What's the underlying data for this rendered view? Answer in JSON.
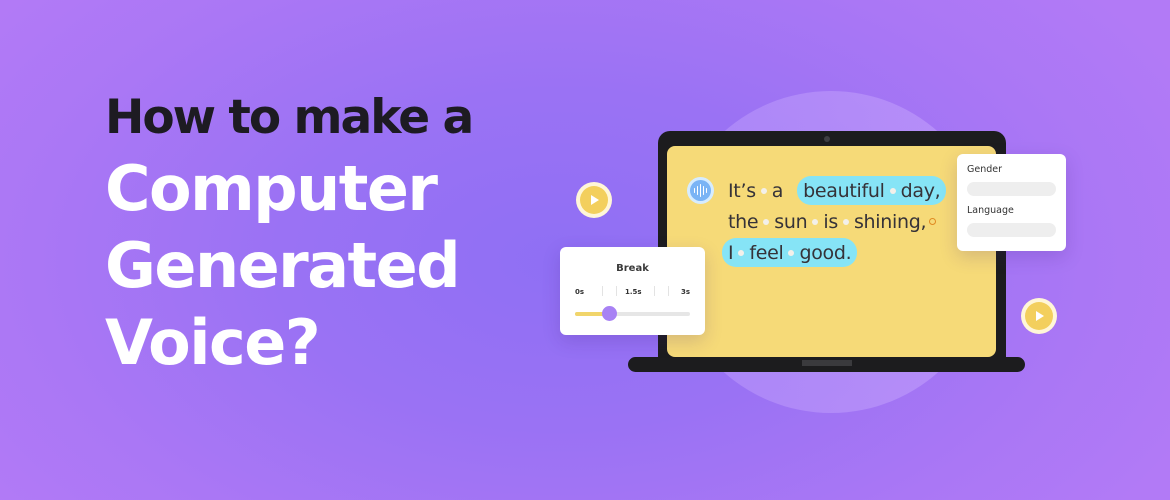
{
  "headline": {
    "line1": "How to make a",
    "line2": "Computer",
    "line3": "Generated",
    "line4": "Voice?"
  },
  "editor": {
    "sentence_lines": [
      [
        "It’s",
        "a",
        "beautiful",
        "day,"
      ],
      [
        "the",
        "sun",
        "is",
        "shining,"
      ],
      [
        "I",
        "feel",
        "good."
      ]
    ],
    "highlighted_phrases": [
      "beautiful day,",
      "I feel good."
    ],
    "icon": "sound-wave-icon"
  },
  "voice_settings": {
    "gender_label": "Gender",
    "gender_value": "",
    "language_label": "Language",
    "language_value": ""
  },
  "break_control": {
    "title": "Break",
    "tick_labels": [
      "0s",
      "1.5s",
      "3s"
    ],
    "min_seconds": 0,
    "max_seconds": 3,
    "value_seconds": 0.9
  },
  "play_buttons": [
    "play-icon",
    "play-icon"
  ],
  "colors": {
    "background": "#9a72f4",
    "screen": "#f6da78",
    "highlight": "#86e4f6",
    "slider_fill": "#f1d56b",
    "slider_thumb": "#a882f4",
    "laptop": "#1c1c1e"
  }
}
